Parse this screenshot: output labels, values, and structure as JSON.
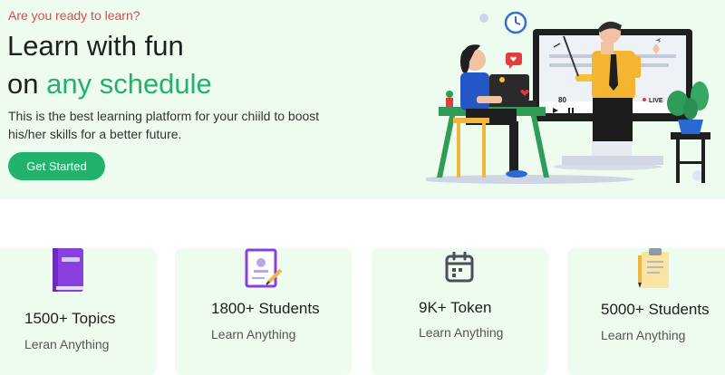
{
  "hero": {
    "eyebrow": "Are you ready to learn?",
    "title_line1": "Learn with fun",
    "title_on": "on",
    "title_accent": "any schedule",
    "description": "This is the best learning platform for your chiild to boost his/her skills for a better future.",
    "cta_label": "Get Started",
    "video_count": "80",
    "live_label": "LIVE"
  },
  "stats": [
    {
      "count": "1500+ Topics",
      "sub": "Leran Anything",
      "icon": "book-icon"
    },
    {
      "count": "1800+ Students",
      "sub": "Learn Anything",
      "icon": "certificate-icon"
    },
    {
      "count": "9K+ Token",
      "sub": "Learn Anything",
      "icon": "calendar-icon"
    },
    {
      "count": "5000+ Students",
      "sub": "Learn Anything",
      "icon": "clipboard-icon"
    }
  ],
  "colors": {
    "accent": "#21b26b",
    "hero_bg": "#edfcee",
    "eyebrow": "#d94b4b"
  }
}
